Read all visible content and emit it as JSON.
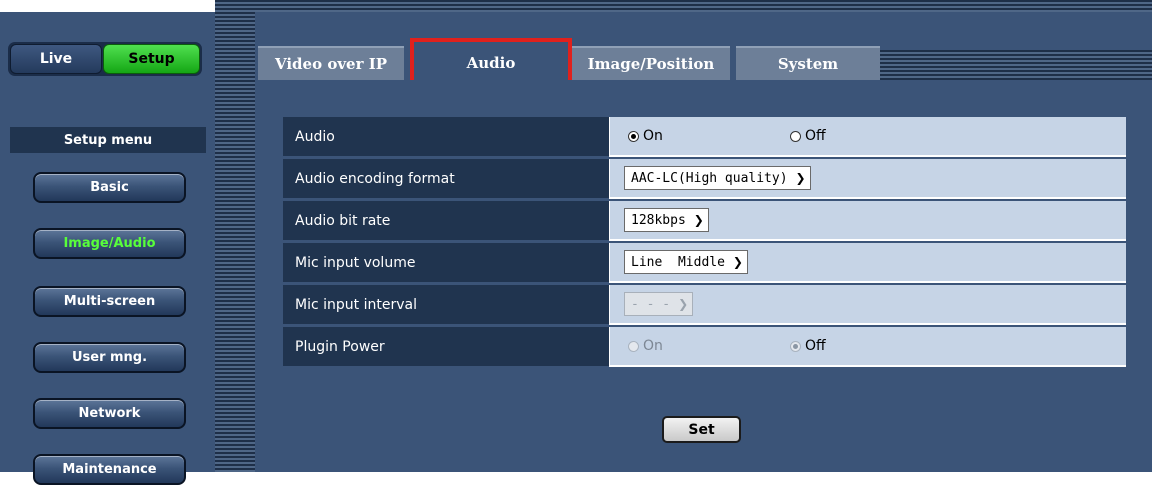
{
  "mode": {
    "live_label": "Live",
    "setup_label": "Setup"
  },
  "sidebar": {
    "title": "Setup menu",
    "items": [
      {
        "label": "Basic"
      },
      {
        "label": "Image/Audio"
      },
      {
        "label": "Multi-screen"
      },
      {
        "label": "User mng."
      },
      {
        "label": "Network"
      },
      {
        "label": "Maintenance"
      }
    ],
    "active_color": "#58ff3a"
  },
  "tabs": [
    {
      "label": "Video over IP"
    },
    {
      "label": "Audio"
    },
    {
      "label": "Image/Position"
    },
    {
      "label": "System"
    }
  ],
  "highlight_color": "#e0211d",
  "settings": {
    "audio": {
      "label": "Audio",
      "on": "On",
      "off": "Off"
    },
    "encoding": {
      "label": "Audio encoding format",
      "value": "AAC-LC(High quality)"
    },
    "bitrate": {
      "label": "Audio bit rate",
      "value": "128kbps"
    },
    "mic_volume": {
      "label": "Mic input volume",
      "value": "Line  Middle"
    },
    "mic_interval": {
      "label": "Mic input interval",
      "value": "- - -"
    },
    "plugin_power": {
      "label": "Plugin Power",
      "on": "On",
      "off": "Off"
    }
  },
  "set_label": "Set"
}
